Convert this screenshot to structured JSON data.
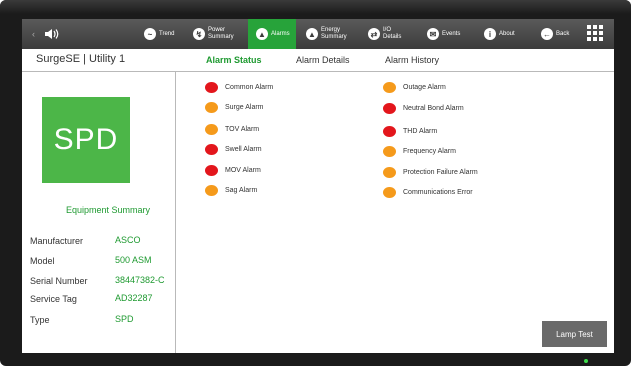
{
  "nav": {
    "items": [
      {
        "id": "speaker",
        "label": "",
        "icon": "speaker-icon"
      },
      {
        "id": "trend",
        "label": "Trend",
        "icon": "trend-icon"
      },
      {
        "id": "power",
        "line1": "Power",
        "line2": "Summary",
        "icon": "power-icon"
      },
      {
        "id": "alarms",
        "label": "Alarms",
        "icon": "alarm-icon",
        "active": true
      },
      {
        "id": "energy",
        "line1": "Energy",
        "line2": "Summary",
        "icon": "energy-icon"
      },
      {
        "id": "io",
        "line1": "I/O",
        "line2": "Details",
        "icon": "io-icon"
      },
      {
        "id": "events",
        "label": "Events",
        "icon": "events-icon"
      },
      {
        "id": "about",
        "label": "About",
        "icon": "info-icon"
      },
      {
        "id": "back",
        "label": "Back",
        "icon": "back-arrow-icon"
      },
      {
        "id": "menu",
        "label": "",
        "icon": "grid-menu-icon"
      }
    ]
  },
  "header": {
    "title": "SurgeSE | Utility 1",
    "tabs": [
      "Alarm Status",
      "Alarm Details",
      "Alarm History"
    ]
  },
  "equipment": {
    "logo_text": "SPD",
    "summary_label": "Equipment Summary",
    "rows": [
      {
        "label": "Manufacturer",
        "value": "ASCO"
      },
      {
        "label": "Model",
        "value": "500 ASM"
      },
      {
        "label": "Serial Number",
        "value": "38447382-C"
      },
      {
        "label": "Service Tag",
        "value": "AD32287"
      },
      {
        "label": "Type",
        "value": "SPD"
      }
    ]
  },
  "alarms": {
    "left": [
      {
        "label": "Common Alarm",
        "status": "red"
      },
      {
        "label": "Surge Alarm",
        "status": "orange"
      },
      {
        "label": "TOV Alarm",
        "status": "orange"
      },
      {
        "label": "Swell Alarm",
        "status": "red"
      },
      {
        "label": "MOV Alarm",
        "status": "red"
      },
      {
        "label": "Sag Alarm",
        "status": "orange"
      }
    ],
    "right": [
      {
        "label": "Outage Alarm",
        "status": "orange"
      },
      {
        "label": "Neutral Bond Alarm",
        "status": "red"
      },
      {
        "label": "THD Alarm",
        "status": "red"
      },
      {
        "label": "Frequency Alarm",
        "status": "orange"
      },
      {
        "label": "Protection Failure Alarm",
        "status": "orange"
      },
      {
        "label": "Communications Error",
        "status": "orange"
      }
    ]
  },
  "lamp_test_label": "Lamp Test",
  "colors": {
    "red": "#e3161c",
    "orange": "#f59a1b",
    "accent_green": "#1f9a31",
    "active_nav": "#27a33a"
  }
}
